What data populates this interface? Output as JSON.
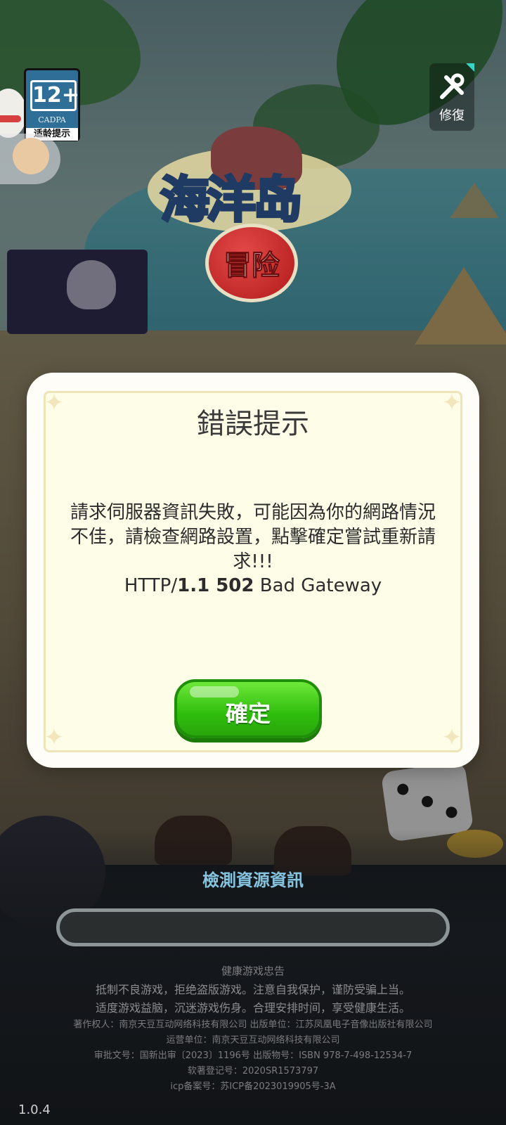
{
  "top_left": {
    "age_rating": "12+",
    "age_org": "CADPA",
    "age_tip": "适龄提示"
  },
  "repair_button": {
    "label": "修復"
  },
  "logo": {
    "title": "海洋岛",
    "subtitle": "冒险"
  },
  "dialog": {
    "title": "錯誤提示",
    "message": "請求伺服器資訊失敗，可能因為你的網路情況不佳，請檢查網路設置，點擊確定嘗試重新請求!!!",
    "http_prefix": "HTTP/",
    "http_bold": "1.1 502",
    "http_suffix": " Bad Gateway",
    "confirm_label": "確定"
  },
  "loading": {
    "label": "檢測資源資訊",
    "progress": 0
  },
  "footer": {
    "lines": [
      "健康游戏忠告",
      "抵制不良游戏，拒绝盗版游戏。注意自我保护，谨防受骗上当。",
      "适度游戏益脑，沉迷游戏伤身。合理安排时间，享受健康生活。",
      "著作权人：南京天豆互动网络科技有限公司   出版单位：江苏凤凰电子音像出版社有限公司",
      "运营单位：南京天豆互动网络科技有限公司",
      "审批文号：国新出审〔2023〕1196号   出版物号：ISBN 978-7-498-12534-7",
      "软著登记号：2020SR1573797",
      "icp备案号：苏ICP备2023019905号-3A"
    ]
  },
  "version": "1.0.4",
  "colors": {
    "confirm_green": "#2fbd0c",
    "dialog_bg": "#fefde8",
    "loading_label": "#86c4e0"
  }
}
